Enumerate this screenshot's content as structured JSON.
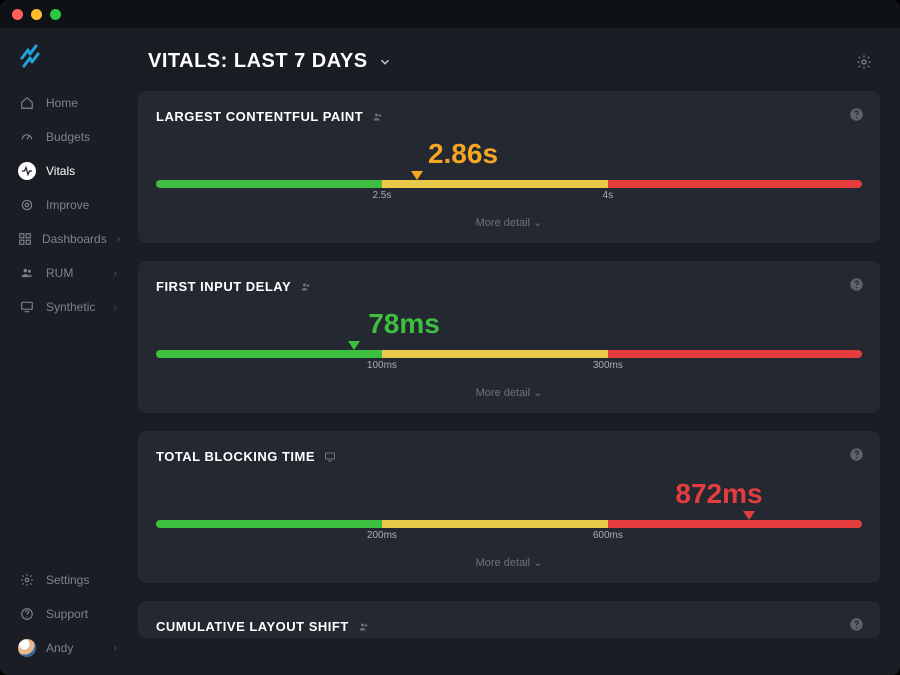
{
  "header": {
    "title": "VITALS: LAST 7 DAYS"
  },
  "sidebar": {
    "items": [
      {
        "label": "Home"
      },
      {
        "label": "Budgets"
      },
      {
        "label": "Vitals"
      },
      {
        "label": "Improve"
      },
      {
        "label": "Dashboards"
      },
      {
        "label": "RUM"
      },
      {
        "label": "Synthetic"
      }
    ],
    "bottom": {
      "settings": "Settings",
      "support": "Support",
      "user": "Andy"
    }
  },
  "cards": {
    "lcp": {
      "title": "LARGEST CONTENTFUL PAINT",
      "value": "2.86s",
      "ticks": [
        "2.5s",
        "4s"
      ],
      "more": "More detail"
    },
    "fid": {
      "title": "FIRST INPUT DELAY",
      "value": "78ms",
      "ticks": [
        "100ms",
        "300ms"
      ],
      "more": "More detail"
    },
    "tbt": {
      "title": "TOTAL BLOCKING TIME",
      "value": "872ms",
      "ticks": [
        "200ms",
        "600ms"
      ],
      "more": "More detail"
    },
    "cls": {
      "title": "CUMULATIVE LAYOUT SHIFT"
    }
  },
  "chart_data": [
    {
      "type": "bar",
      "metric": "Largest Contentful Paint",
      "value": 2.86,
      "unit": "s",
      "thresholds": {
        "good_max": 2.5,
        "needs_improvement_max": 4
      },
      "status": "needs-improvement"
    },
    {
      "type": "bar",
      "metric": "First Input Delay",
      "value": 78,
      "unit": "ms",
      "thresholds": {
        "good_max": 100,
        "needs_improvement_max": 300
      },
      "status": "good"
    },
    {
      "type": "bar",
      "metric": "Total Blocking Time",
      "value": 872,
      "unit": "ms",
      "thresholds": {
        "good_max": 200,
        "needs_improvement_max": 600
      },
      "status": "poor"
    }
  ],
  "colors": {
    "good": "#3fbf3f",
    "needs_improvement": "#e8c94a",
    "poor": "#e53d3d",
    "accent_orange": "#f6a623"
  }
}
